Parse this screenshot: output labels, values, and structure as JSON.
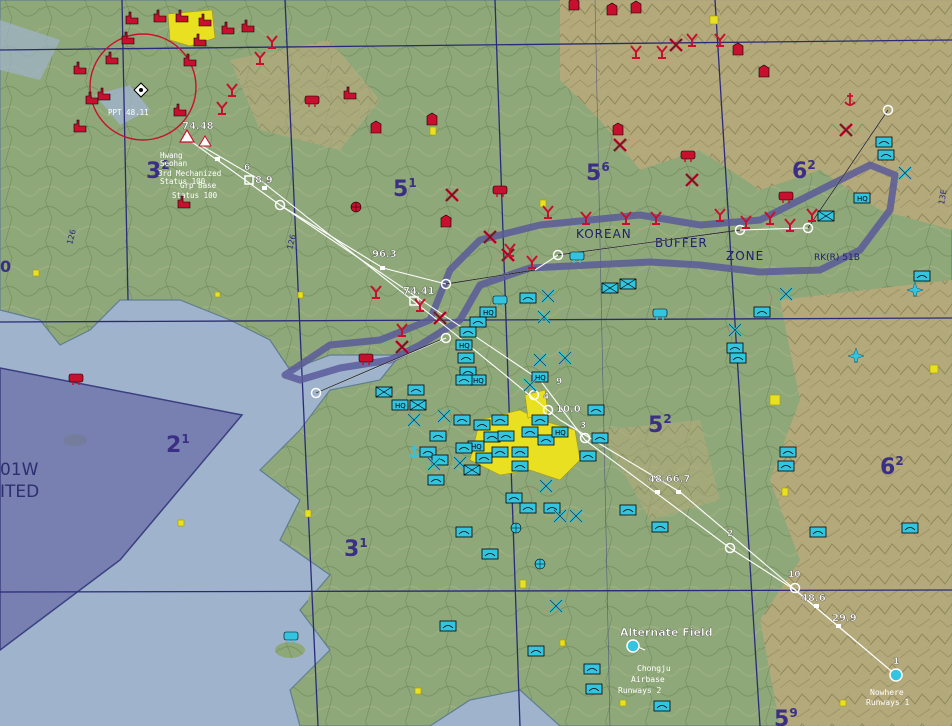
{
  "colors": {
    "sea": "#9fb3cc",
    "land": "#8fa87a",
    "hills": "#b6a878",
    "grid": "#2a2a7a",
    "buffer": "#5b5b9a",
    "restricted": "#6b6fa8",
    "friendly": "#33c4e0",
    "enemy": "#c8102e",
    "urban": "#e8e020",
    "route": "#ffffff"
  },
  "grid_labels": [
    "3",
    "5",
    "5",
    "6",
    "2",
    "3",
    "5",
    "6",
    "5"
  ],
  "grid_superscripts": [
    "2",
    "1",
    "6",
    "2",
    "1",
    "1",
    "2",
    "2",
    "9"
  ],
  "left_edge_labels": {
    "zero": "0",
    "code": "01W",
    "status": "ITED"
  },
  "buffer_zone": {
    "word1": "KOREAN",
    "word2": "BUFFER",
    "word3": "ZONE",
    "tag": "RK(R) 51B"
  },
  "route_labels": [
    "74.48",
    "6",
    "8.9",
    "96.3",
    "74.41",
    "9",
    "4",
    "10.0",
    "3",
    "48.66.7",
    "2",
    "10",
    "48.6",
    "29.9",
    "1"
  ],
  "start_info": {
    "line1": "PPT 48.11",
    "line2": "Hwang",
    "line3": "Seohan",
    "line4": "3rd Mechanized",
    "line5": "Status 100",
    "line6": "Grp Base",
    "line7": "Status 100"
  },
  "alternate_field": {
    "label": "Alternate Field",
    "line1": "Chongju",
    "line2": "Airbase",
    "line3": "Runways 2"
  },
  "destination": {
    "line1": "Nowhere",
    "line2": "Runways 1"
  },
  "longitude_ticks": [
    "126",
    "126",
    "13E"
  ],
  "icons": {
    "hq": "HQ",
    "mech": "mech-unit-icon"
  }
}
